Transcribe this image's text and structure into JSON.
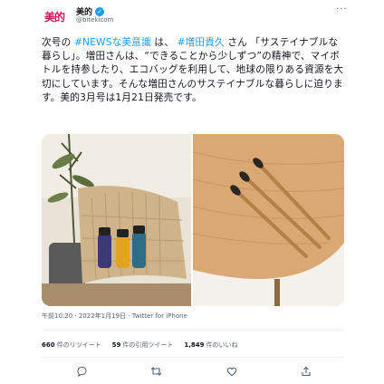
{
  "account": {
    "avatar_text": "美的",
    "display_name": "美的",
    "handle": "@bitekicom"
  },
  "tweet": {
    "segments": [
      {
        "text": "次号の ",
        "type": "plain"
      },
      {
        "text": "#NEWSな美意識",
        "type": "hashtag"
      },
      {
        "text": " は、 ",
        "type": "plain"
      },
      {
        "text": "#増田貴久",
        "type": "hashtag"
      },
      {
        "text": " さん 「サステイナブルな暮らし」。増田さんは、“できることから少しずつ”の精神で、マイボトルを持参したり、エコバッグを利用して、地球の限りある資源を大切にしています。そんな増田さんのサステイナブルな暮らしに迫ります。美的3月号は1月21日発売です。",
        "type": "plain"
      }
    ]
  },
  "media": {
    "left_alt": "椅子の上に並ぶカラフルなマイボトル",
    "right_alt": "木製テーブルの上の竹歯ブラシ"
  },
  "meta": {
    "text": "午前10:20 · 2022年1月19日 · Twitter for iPhone"
  },
  "stats": {
    "retweets_count": "660",
    "retweets_label": "件のリツイート",
    "quotes_count": "59",
    "quotes_label": "件の引用ツイート",
    "likes_count": "1,849",
    "likes_label": "件のいいね"
  },
  "icons": {
    "more": "more-dots-icon",
    "reply": "reply-icon",
    "retweet": "retweet-icon",
    "like": "heart-icon",
    "share": "share-icon",
    "verified": "verified-badge-icon"
  },
  "colors": {
    "brand": "#d4145a",
    "link": "#1d9bf0",
    "secondary_text": "#536471"
  }
}
